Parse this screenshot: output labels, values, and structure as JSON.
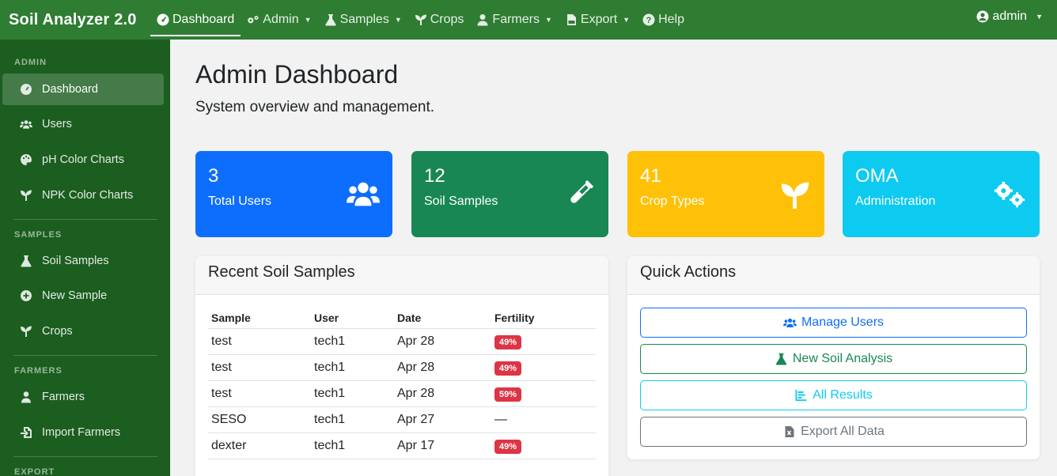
{
  "brand": "Soil Analyzer 2.0",
  "nav": {
    "dashboard": "Dashboard",
    "admin": "Admin",
    "samples": "Samples",
    "crops": "Crops",
    "farmers": "Farmers",
    "export": "Export",
    "help": "Help",
    "user": "admin"
  },
  "sidebar": {
    "admin_head": "ADMIN",
    "samples_head": "SAMPLES",
    "farmers_head": "FARMERS",
    "export_head": "EXPORT",
    "items": {
      "dashboard": "Dashboard",
      "users": "Users",
      "ph_charts": "pH Color Charts",
      "npk_charts": "NPK Color Charts",
      "soil_samples": "Soil Samples",
      "new_sample": "New Sample",
      "crops": "Crops",
      "farmers": "Farmers",
      "import_farmers": "Import Farmers"
    }
  },
  "page": {
    "title": "Admin Dashboard",
    "subtitle": "System overview and management."
  },
  "stats": {
    "users": {
      "value": "3",
      "label": "Total Users",
      "color": "#0d6efd"
    },
    "samples": {
      "value": "12",
      "label": "Soil Samples",
      "color": "#198754"
    },
    "crops": {
      "value": "41",
      "label": "Crop Types",
      "color": "#ffc107"
    },
    "admin": {
      "value": "OMA",
      "label": "Administration",
      "color": "#0dcaf0"
    }
  },
  "recent": {
    "title": "Recent Soil Samples",
    "headers": {
      "sample": "Sample",
      "user": "User",
      "date": "Date",
      "fertility": "Fertility"
    },
    "rows": [
      {
        "sample": "test",
        "user": "tech1",
        "date": "Apr 28",
        "fertility": "49%"
      },
      {
        "sample": "test",
        "user": "tech1",
        "date": "Apr 28",
        "fertility": "49%"
      },
      {
        "sample": "test",
        "user": "tech1",
        "date": "Apr 28",
        "fertility": "59%"
      },
      {
        "sample": "SESO",
        "user": "tech1",
        "date": "Apr 27",
        "fertility": "—"
      },
      {
        "sample": "dexter",
        "user": "tech1",
        "date": "Apr 17",
        "fertility": "49%"
      }
    ]
  },
  "quick": {
    "title": "Quick Actions",
    "manage_users": "Manage Users",
    "new_analysis": "New Soil Analysis",
    "all_results": "All Results",
    "export_all": "Export All Data"
  }
}
